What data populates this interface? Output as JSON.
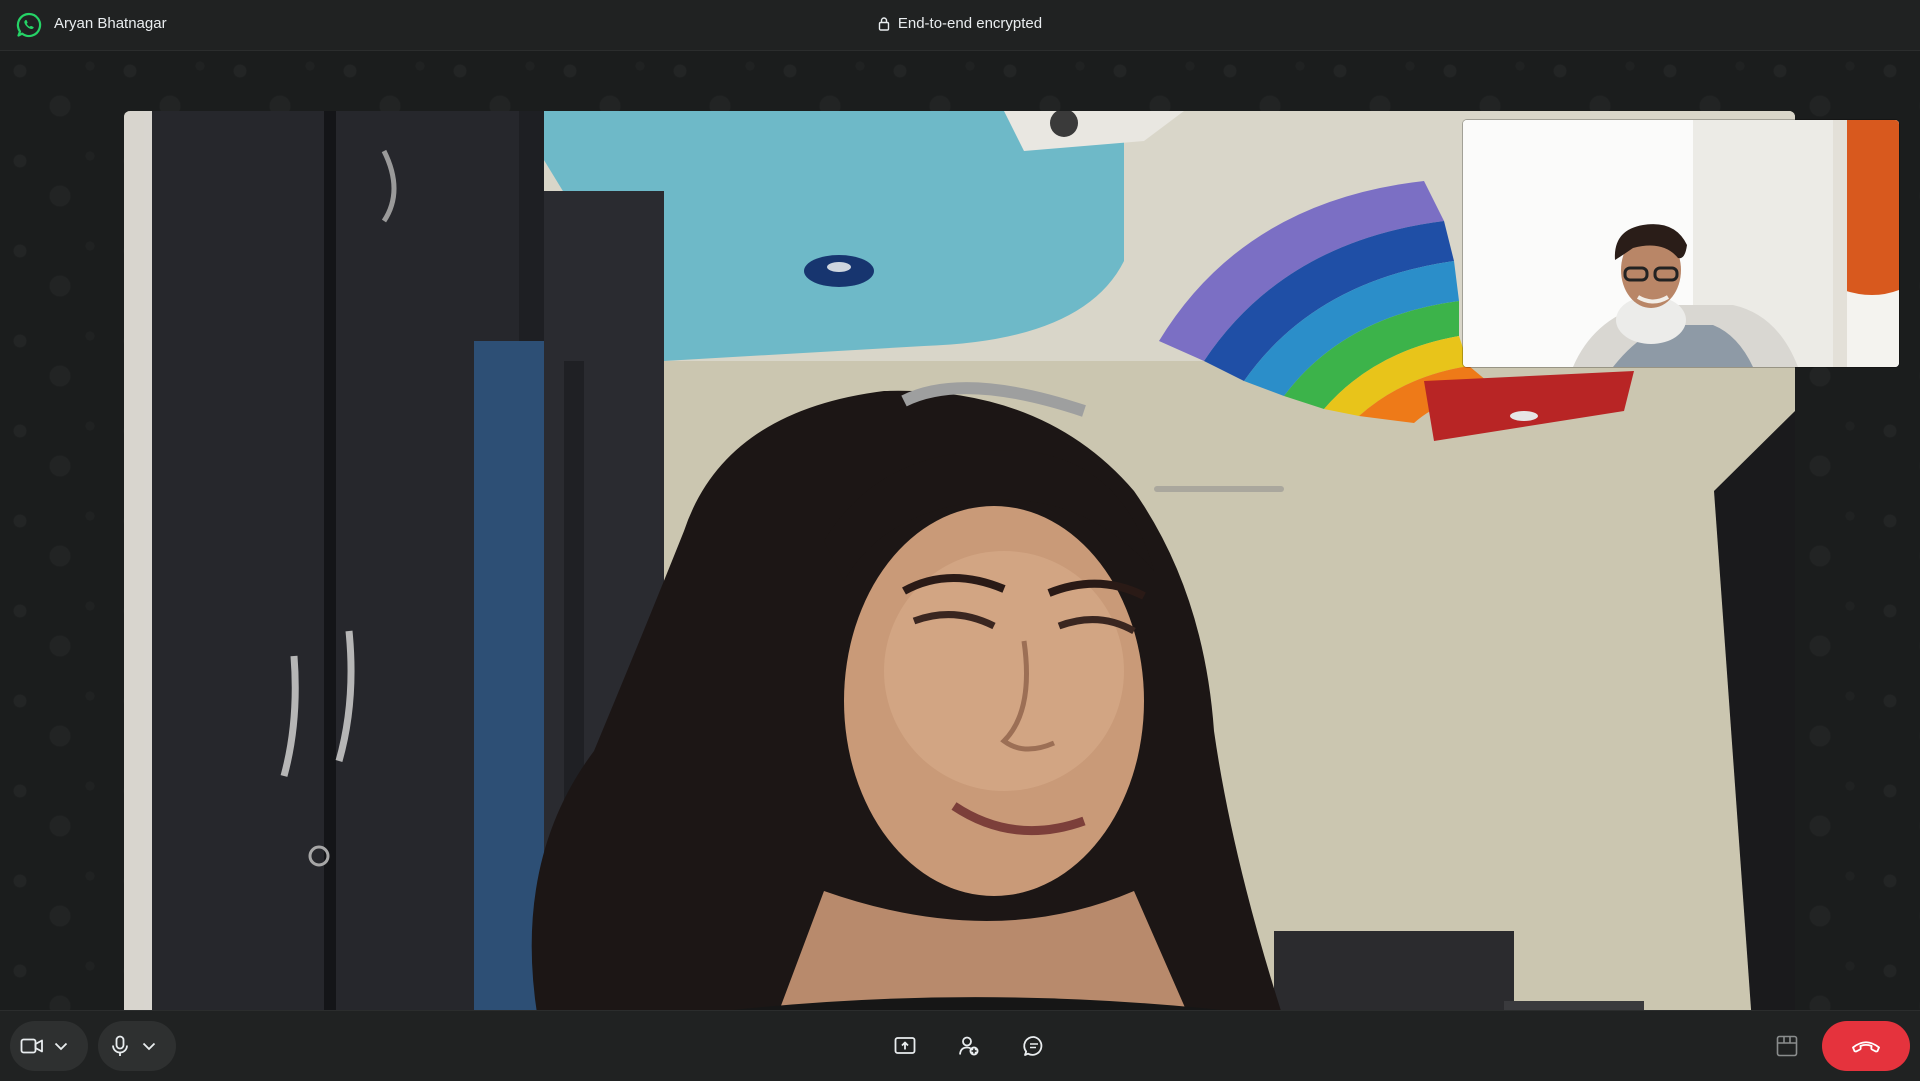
{
  "titlebar": {
    "caller_name": "Aryan Bhatnagar",
    "encryption_label": "End-to-end encrypted",
    "app_icon": "whatsapp-logo"
  },
  "call": {
    "remote_video": {
      "subject": "remote-participant-video"
    },
    "self_video": {
      "subject": "self-view-video"
    }
  },
  "controls": {
    "camera": {
      "icon": "video-camera-icon",
      "menu_icon": "chevron-down-icon"
    },
    "microphone": {
      "icon": "microphone-icon",
      "menu_icon": "chevron-down-icon"
    },
    "share_screen": {
      "icon": "share-screen-icon"
    },
    "add_participant": {
      "icon": "add-person-icon"
    },
    "chat": {
      "icon": "chat-bubble-icon"
    },
    "layout": {
      "icon": "grid-layout-icon"
    },
    "end_call": {
      "icon": "end-call-icon"
    }
  },
  "colors": {
    "brand_green": "#25d366",
    "end_call_red": "#e5333d",
    "background": "#1d1f1f"
  }
}
